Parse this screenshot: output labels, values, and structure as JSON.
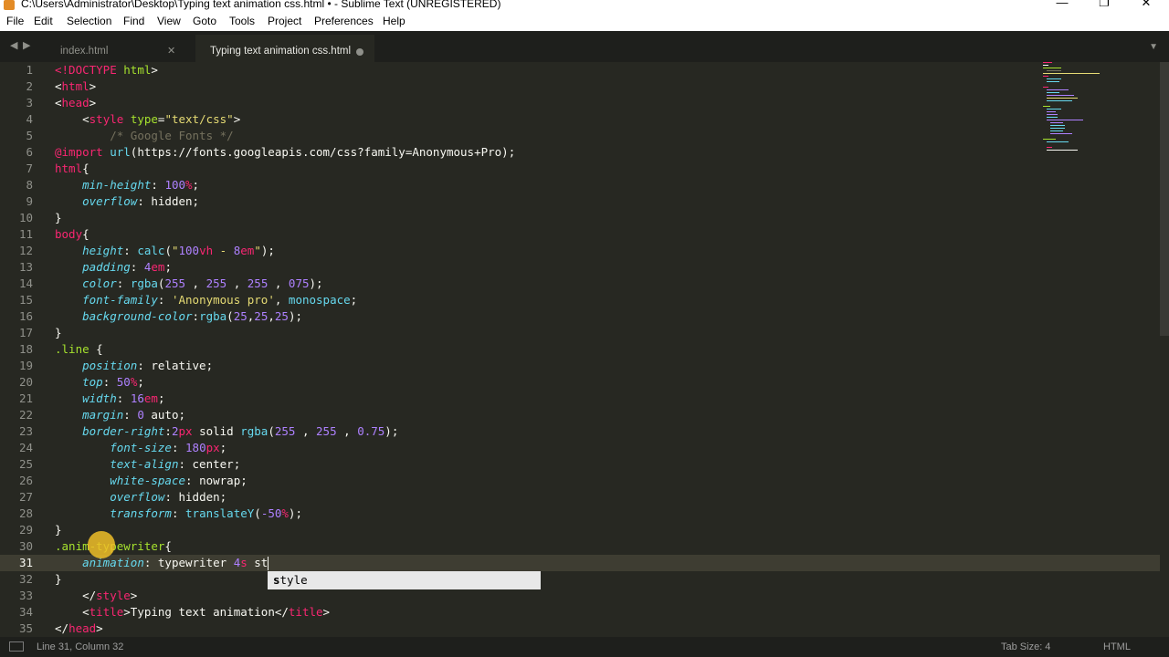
{
  "window": {
    "title": "C:\\Users\\Administrator\\Desktop\\Typing text animation css.html • - Sublime Text (UNREGISTERED)",
    "app_icon": "sublime-text-icon",
    "controls": {
      "minimize": "—",
      "maximize": "❐",
      "close": "✕"
    }
  },
  "menu": [
    "File",
    "Edit",
    "Selection",
    "Find",
    "View",
    "Goto",
    "Tools",
    "Project",
    "Preferences",
    "Help"
  ],
  "tab_nav": {
    "prev": "◀",
    "next": "▶"
  },
  "tabs": [
    {
      "label": "index.html",
      "close": "✕",
      "active": false
    },
    {
      "label": "Typing text animation css.html",
      "active": true,
      "dirty": true
    }
  ],
  "tab_menu_icon": "▼",
  "editor": {
    "current_line": 31,
    "line_numbers": [
      "1",
      "2",
      "3",
      "4",
      "5",
      "6",
      "7",
      "8",
      "9",
      "10",
      "11",
      "12",
      "13",
      "14",
      "15",
      "16",
      "17",
      "18",
      "19",
      "20",
      "21",
      "22",
      "23",
      "24",
      "25",
      "26",
      "27",
      "28",
      "29",
      "30",
      "31",
      "32",
      "33",
      "34",
      "35"
    ]
  },
  "autocomplete": {
    "match": "s",
    "rest": "tyle"
  },
  "status": {
    "position": "Line 31, Column 32",
    "tab_size": "Tab Size: 4",
    "syntax": "HTML"
  },
  "colors": {
    "background": "#272822",
    "tag": "#f92672",
    "attr": "#a6e22e",
    "string": "#e6db74",
    "number": "#ae81ff",
    "property": "#66d9ef",
    "comment": "#75715e"
  }
}
